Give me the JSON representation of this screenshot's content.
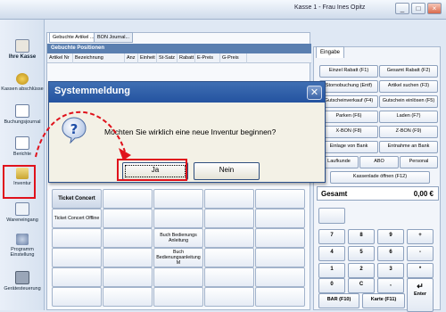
{
  "window": {
    "title": "Kasse 1 - Frau Ines Opitz",
    "min_label": "_",
    "max_label": "□",
    "close_label": "×"
  },
  "sidebar": {
    "items": [
      {
        "label": "Ihre Kasse",
        "icon": "clipboard-icon"
      },
      {
        "label": "Kassen abschlüsse",
        "icon": "coins-icon"
      },
      {
        "label": "Buchungsjournal",
        "icon": "journal-icon"
      },
      {
        "label": "Berichte",
        "icon": "report-icon"
      },
      {
        "label": "Inventur",
        "icon": "inventory-icon"
      },
      {
        "label": "Wareneingang",
        "icon": "goods-receipt-icon"
      },
      {
        "label": "Programm Einstellung",
        "icon": "settings-icon"
      },
      {
        "label": "Gerätesteuerung",
        "icon": "device-icon"
      }
    ]
  },
  "center": {
    "tabs": [
      "Gebuchte Artikel ...",
      "BON Journal..."
    ],
    "section_title": "Gebuchte Positionen",
    "columns": [
      "Artikel Nr",
      "Bezeichnung",
      "Anz",
      "Einheit",
      "St-Satz",
      "Rabatt",
      "E-Preis",
      "G-Preis"
    ],
    "grid_buttons": {
      "ticket_concert": "Ticket Concert",
      "ticket_concert_offline": "Ticket Concert Offline",
      "buch_anleitung": "Buch Bedienungs Anleitung",
      "buch_anleitung_m": "Buch Bedienungsanleitung M"
    }
  },
  "right": {
    "tab_label": "Eingabe",
    "buttons": [
      "Einzel Rabatt (F1)",
      "Gesamt Rabatt (F2)",
      "Stornobuchung (Entf)",
      "Artikel suchen (F3)",
      "Gutscheinverkauf (F4)",
      "Gutschein einlösen (F5)",
      "Parken (F6)",
      "Laden (F7)",
      "X-BON (F8)",
      "Z-BON (F9)",
      "Einlage von Bank",
      "Entnahme an Bank",
      "Laufkunde",
      "ABO",
      "Personal",
      "Kassenlade öffnen (F12)"
    ],
    "total_label": "Gesamt",
    "total_value": "0,00 €",
    "keypad": [
      "7",
      "8",
      "9",
      "+",
      "4",
      "5",
      "6",
      "-",
      "1",
      "2",
      "3",
      "*",
      "0",
      "C",
      ","
    ],
    "bar_label": "BAR (F10)",
    "card_label": "Karte (F11)",
    "enter_label": "Enter",
    "enter_symbol": "↵"
  },
  "dialog": {
    "title": "Systemmeldung",
    "close": "✕",
    "message": "Möchten Sie wirklich eine neue Inventur beginnen?",
    "icon": "question-icon",
    "yes": "Ja",
    "no": "Nein"
  },
  "annotation_color": "#e0121c"
}
